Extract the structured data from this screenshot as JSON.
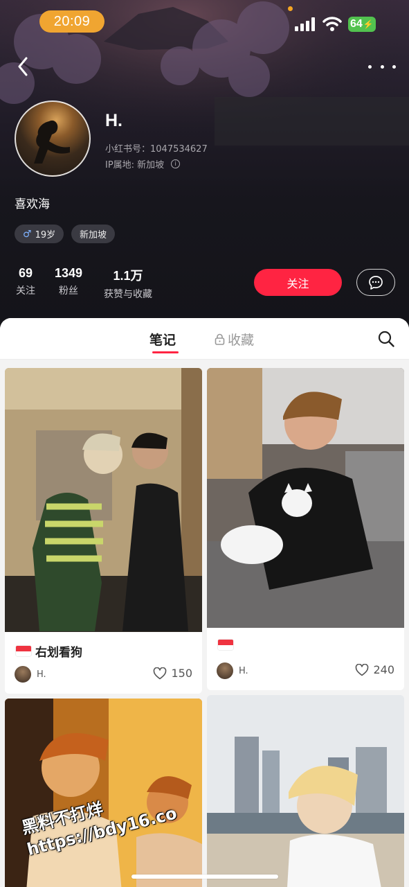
{
  "status_bar": {
    "time": "20:09",
    "battery": "64"
  },
  "profile": {
    "name": "H.",
    "red_id": "小红书号：1047534627",
    "ip_location": "IP属地: 新加坡",
    "bio": "喜欢海",
    "tags": [
      {
        "label": "19岁",
        "icon": "male-icon"
      },
      {
        "label": "新加坡"
      }
    ],
    "stats": [
      {
        "value": "69",
        "label": "关注"
      },
      {
        "value": "1349",
        "label": "粉丝"
      },
      {
        "value": "1.1万",
        "label": "获赞与收藏"
      }
    ],
    "follow_label": "关注"
  },
  "tabs": {
    "notes": "笔记",
    "collections": "收藏",
    "active": "notes"
  },
  "notes": [
    {
      "title": "右划看狗",
      "flag": "singapore-flag",
      "author": "H.",
      "likes": "150"
    },
    {
      "title": "",
      "flag": "singapore-flag",
      "author": "H.",
      "likes": "240"
    },
    {
      "title": "",
      "author": "",
      "likes": ""
    },
    {
      "title": "",
      "author": "",
      "likes": ""
    }
  ],
  "watermark": {
    "line1": "黑料不打烊",
    "line2": "https://bdy16.co"
  },
  "colors": {
    "accent": "#ff2442",
    "header_bg": "#17161d",
    "time_pill": "#f0a531",
    "battery": "#52c24f"
  }
}
